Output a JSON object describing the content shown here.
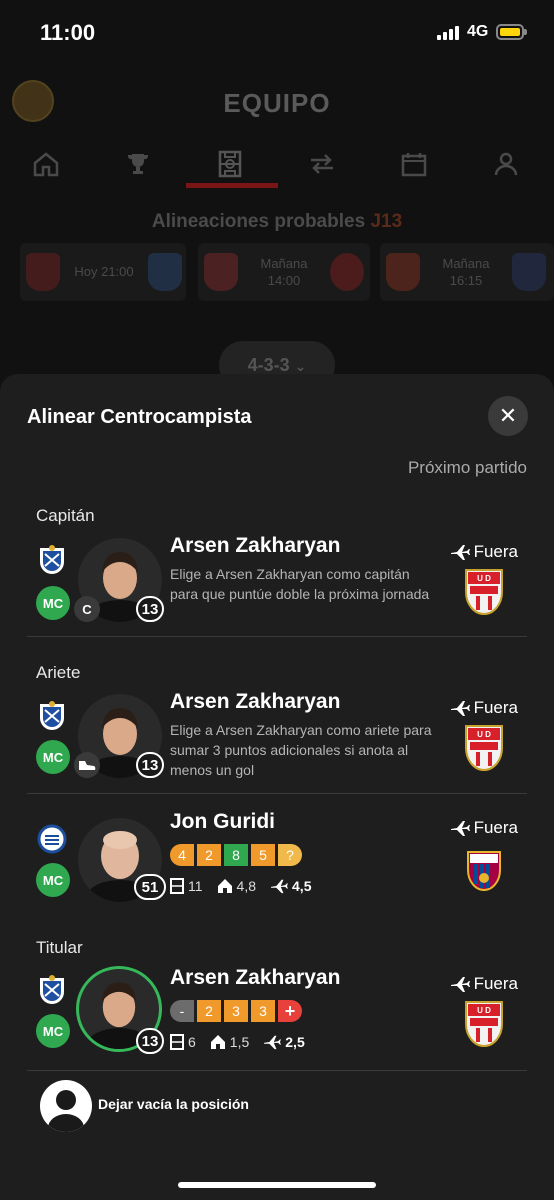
{
  "status_bar": {
    "time": "11:00",
    "network": "4G"
  },
  "header": {
    "title": "EQUIPO"
  },
  "nav_tabs": [
    "home-icon",
    "trophy-icon",
    "field-icon",
    "transfer-icon",
    "calendar-icon",
    "users-icon"
  ],
  "probable_lineups": {
    "title": "Alineaciones probables",
    "round": "J13",
    "matches": [
      {
        "time": "Hoy 21:00"
      },
      {
        "time": "Mañana 14:00"
      },
      {
        "time": "Mañana 16:15"
      }
    ]
  },
  "formation": "4-3-3",
  "sheet": {
    "title": "Alinear Centrocampista",
    "close_icon": "close-icon",
    "next_match_label": "Próximo partido",
    "groups": {
      "captain": "Capitán",
      "striker": "Ariete",
      "starter": "Titular"
    },
    "rows": [
      {
        "name": "Arsen Zakharyan",
        "position": "MC",
        "number": "13",
        "role": "C",
        "description": "Elige a Arsen Zakharyan como capitán para que puntúe doble la próxima jornada",
        "venue": "Fuera"
      },
      {
        "name": "Arsen Zakharyan",
        "position": "MC",
        "number": "13",
        "role": "boot-icon",
        "description": "Elige a Arsen Zakharyan como ariete para sumar 3 puntos adicionales si anota al menos un gol",
        "venue": "Fuera"
      },
      {
        "name": "Jon Guridi",
        "position": "MC",
        "number": "51",
        "scores": [
          "4",
          "2",
          "8",
          "5",
          "?"
        ],
        "stats": {
          "all": "11",
          "home": "4,8",
          "away": "4,5"
        },
        "venue": "Fuera"
      },
      {
        "name": "Arsen Zakharyan",
        "position": "MC",
        "number": "13",
        "scores": [
          "-",
          "2",
          "3",
          "3",
          "+"
        ],
        "stats": {
          "all": "6",
          "home": "1,5",
          "away": "2,5"
        },
        "venue": "Fuera"
      }
    ],
    "empty_slot_label": "Dejar vacía la posición"
  },
  "colors": {
    "score_orange": "#f09a2c",
    "score_grey": "#6c6c6c",
    "score_red": "#e8403a",
    "position_green": "#2fa84f",
    "sheet_bg": "#1e1e1e"
  }
}
